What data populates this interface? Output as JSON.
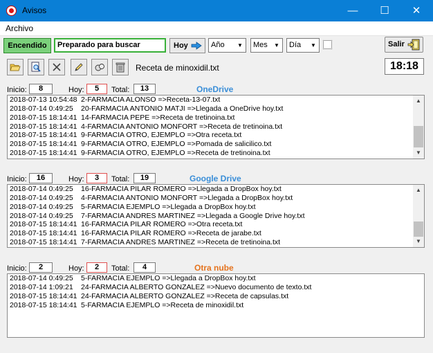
{
  "window": {
    "title": "Avisos",
    "minimize": "—",
    "maximize": "☐",
    "close": "✕"
  },
  "menu": {
    "archivo": "Archivo"
  },
  "toolbar": {
    "status_button": "Encendido",
    "status_text": "Preparado para buscar",
    "hoy_button": "Hoy",
    "year_combo": "Año",
    "month_combo": "Mes",
    "day_combo": "Día",
    "exit_button": "Salir",
    "file_label": "Receta de minoxidil.txt",
    "clock": "18:18",
    "icons": [
      "open-folder-icon",
      "document-search-icon",
      "delete-x-icon",
      "pencil-icon",
      "clear-icon",
      "trash-icon"
    ]
  },
  "labels": {
    "inicio": "Inicio:",
    "hoy": "Hoy:",
    "total": "Total:"
  },
  "sections": [
    {
      "title": "OneDrive",
      "title_color": "#3a8ed8",
      "inicio": "8",
      "hoy": "5",
      "total": "13",
      "rows": [
        {
          "ts": "2018-07-13 10:54:48",
          "text": "2-FARMACIA ALONSO =>Receta-13-07.txt"
        },
        {
          "ts": "2018-07-14 0:49:25",
          "text": "20-FARMACIA ANTONIO MATJI =>Llegada a OneDrive hoy.txt"
        },
        {
          "ts": "2018-07-15 18:14:41",
          "text": "14-FARMACIA PEPE =>Receta de tretinoina.txt"
        },
        {
          "ts": "2018-07-15 18:14:41",
          "text": "4-FARMACIA ANTONIO MONFORT =>Receta de tretinoina.txt"
        },
        {
          "ts": "2018-07-15 18:14:41",
          "text": "9-FARMACIA OTRO, EJEMPLO =>Otra receta.txt"
        },
        {
          "ts": "2018-07-15 18:14:41",
          "text": "9-FARMACIA OTRO, EJEMPLO =>Pomada de salicilico.txt"
        },
        {
          "ts": "2018-07-15 18:14:41",
          "text": "9-FARMACIA OTRO, EJEMPLO =>Receta de tretinoina.txt"
        }
      ]
    },
    {
      "title": "Google Drive",
      "title_color": "#3a8ed8",
      "inicio": "16",
      "hoy": "3",
      "total": "19",
      "rows": [
        {
          "ts": "2018-07-14 0:49:25",
          "text": "16-FARMACIA PILAR ROMERO =>Llegada a DropBox hoy.txt"
        },
        {
          "ts": "2018-07-14 0:49:25",
          "text": "4-FARMACIA ANTONIO MONFORT =>Llegada a DropBox hoy.txt"
        },
        {
          "ts": "2018-07-14 0:49:25",
          "text": "5-FARMACIA EJEMPLO =>Llegada a DropBox hoy.txt"
        },
        {
          "ts": "2018-07-14 0:49:25",
          "text": "7-FARMACIA ANDRES MARTINEZ =>Llegada a Google Drive hoy.txt"
        },
        {
          "ts": "2018-07-15 18:14:41",
          "text": "16-FARMACIA PILAR ROMERO =>Otra receta.txt"
        },
        {
          "ts": "2018-07-15 18:14:41",
          "text": "16-FARMACIA PILAR ROMERO =>Receta de jarabe.txt"
        },
        {
          "ts": "2018-07-15 18:14:41",
          "text": "7-FARMACIA ANDRES MARTINEZ =>Receta de tretinoina.txt"
        }
      ]
    },
    {
      "title": "Otra nube",
      "title_color": "#e5731e",
      "inicio": "2",
      "hoy": "2",
      "total": "4",
      "rows": [
        {
          "ts": "2018-07-14 0:49:25",
          "text": "5-FARMACIA EJEMPLO =>Llegada a DropBox hoy.txt"
        },
        {
          "ts": "2018-07-14 1:09:21",
          "text": "24-FARMACIA ALBERTO GONZALEZ =>Nuevo documento de texto.txt"
        },
        {
          "ts": "2018-07-15 18:14:41",
          "text": "24-FARMACIA ALBERTO GONZALEZ =>Receta de capsulas.txt"
        },
        {
          "ts": "2018-07-15 18:14:41",
          "text": "5-FARMACIA EJEMPLO =>Receta de minoxidil.txt"
        }
      ]
    }
  ]
}
